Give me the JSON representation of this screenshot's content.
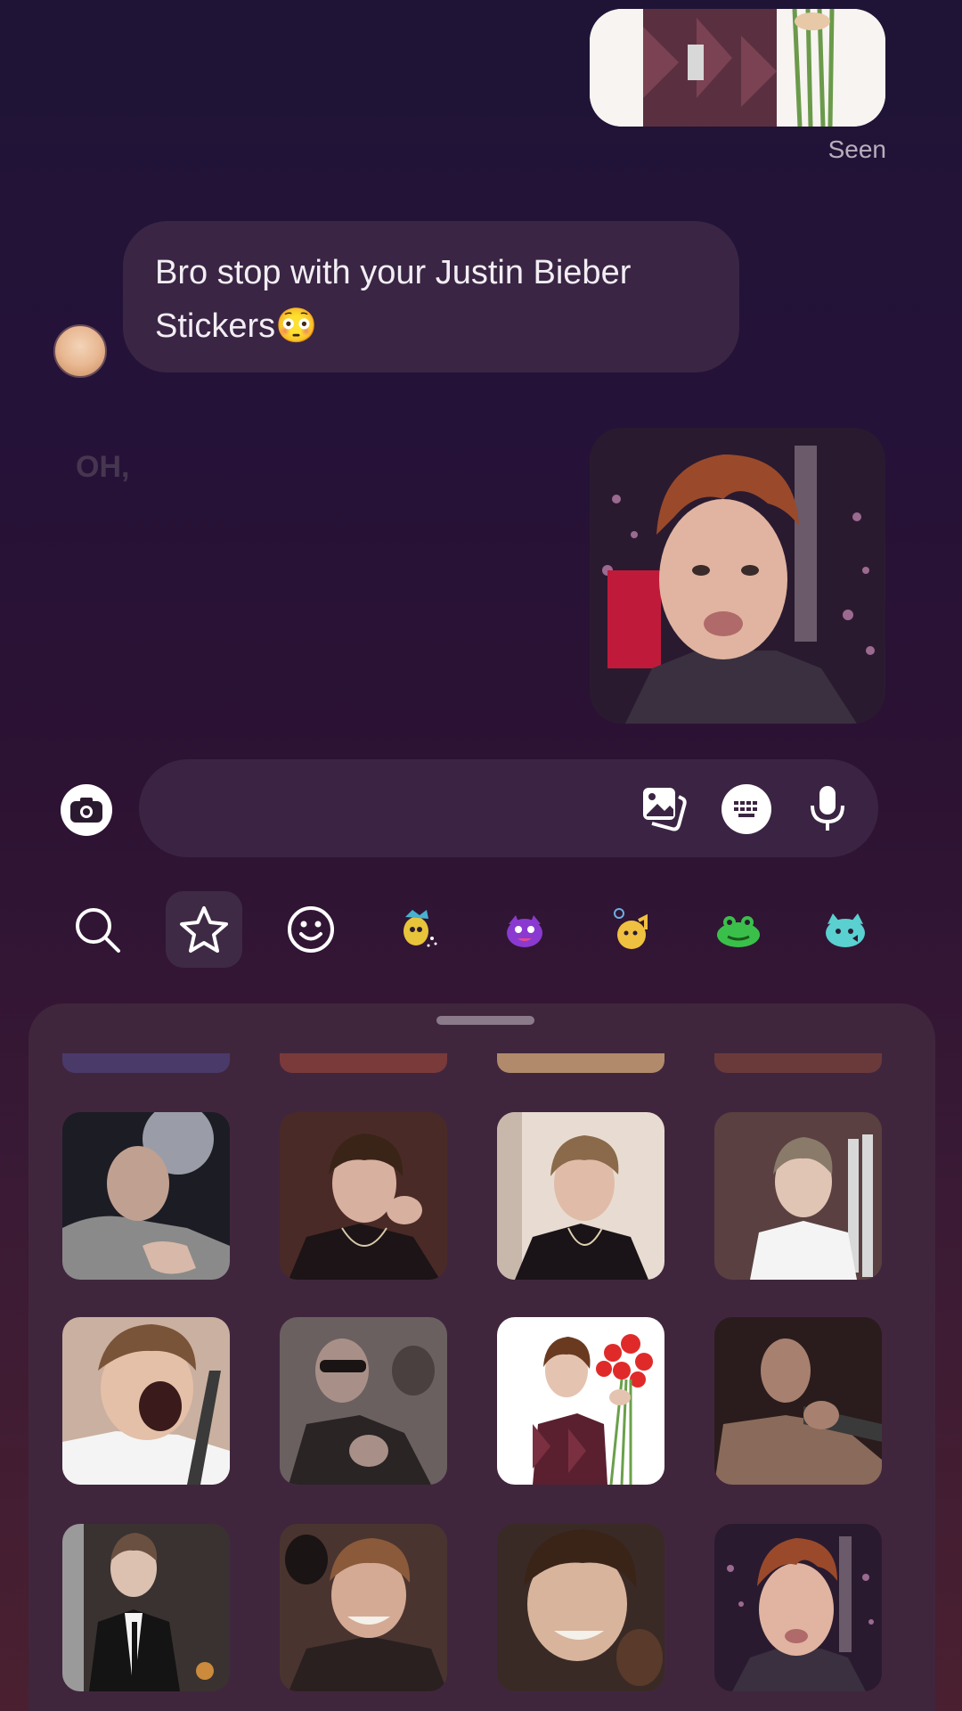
{
  "chat": {
    "seen_label": "Seen",
    "received_message": "Bro stop with your Justin Bieber Stickers😳",
    "ghost_text": "OH,"
  },
  "composer": {
    "camera_icon": "camera-icon",
    "gallery_icon": "gallery-icon",
    "sticker_keyboard_icon": "keyboard-icon",
    "mic_icon": "microphone-icon"
  },
  "sticker_tabs": [
    {
      "name": "search",
      "icon": "search-icon"
    },
    {
      "name": "favorites",
      "icon": "star-icon",
      "active": true
    },
    {
      "name": "emoji",
      "icon": "smiley-icon"
    },
    {
      "name": "pack-1",
      "icon": "sticker-pack-icon"
    },
    {
      "name": "pack-2",
      "icon": "sticker-pack-icon"
    },
    {
      "name": "pack-3",
      "icon": "sticker-pack-icon"
    },
    {
      "name": "pack-4",
      "icon": "sticker-pack-icon"
    },
    {
      "name": "pack-5",
      "icon": "sticker-pack-icon"
    }
  ],
  "colors": {
    "bubble": "#3a2544",
    "tray": "#40263d",
    "accent_text": "#f2eef4"
  }
}
